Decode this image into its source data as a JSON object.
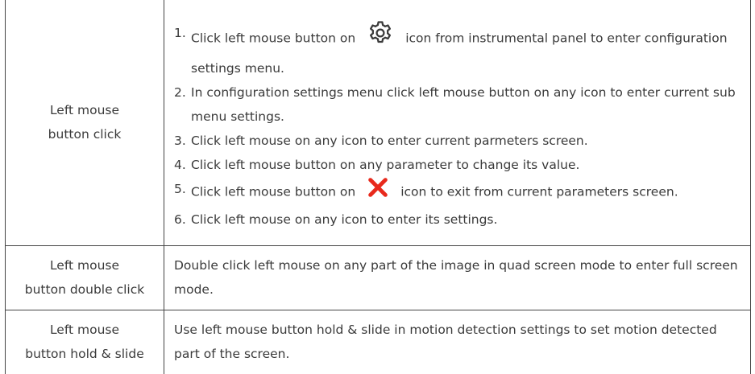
{
  "rows": [
    {
      "action": [
        "Left mouse",
        "button click"
      ],
      "steps": [
        {
          "num": "1.",
          "before": "Click left mouse button on",
          "icon": "gear-icon",
          "after": "icon from instrumental panel to enter configuration settings menu."
        },
        {
          "num": "2.",
          "text": "In configuration settings menu click left mouse button on any icon to enter current sub menu settings."
        },
        {
          "num": "3.",
          "text": "Click left mouse on any icon to enter current parmeters screen."
        },
        {
          "num": "4.",
          "text": "Click left mouse button on any parameter to change its value."
        },
        {
          "num": "5.",
          "before": "Click left mouse button on",
          "icon": "close-icon",
          "after": "icon to exit from current parameters screen."
        },
        {
          "num": "6.",
          "text": "Click left mouse on any icon to enter its settings."
        }
      ]
    },
    {
      "action": [
        "Left mouse",
        "button double click"
      ],
      "text": "Double click left mouse on any part of the image in quad screen mode to enter full screen mode."
    },
    {
      "action": [
        "Left mouse",
        "button hold & slide"
      ],
      "text": "Use left mouse button hold & slide in motion detection settings to set motion detected part of the screen."
    }
  ],
  "colors": {
    "text": "#3a3a3a",
    "border": "#444444",
    "close_icon": "#e8291c"
  }
}
